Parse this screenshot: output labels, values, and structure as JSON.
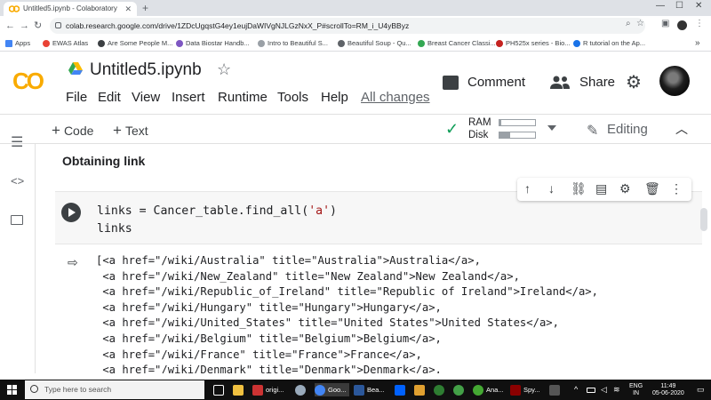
{
  "browser": {
    "tab_title": "Untitled5.ipynb - Colaboratory",
    "url": "colab.research.google.com/drive/1ZDcUgqstG4ey1eujDaWIVgNJLGzNxX_P#scrollTo=RM_i_U4yBByz",
    "bookmarks": [
      "Apps",
      "EWAS Atlas",
      "Are Some People M...",
      "Data Biostar Handb...",
      "Intro to Beautiful S...",
      "Beautiful Soup - Qu...",
      "Breast Cancer Classi...",
      "PH525x series - Bio...",
      "R tutorial on the Ap..."
    ]
  },
  "colab": {
    "logo": "CO",
    "title": "Untitled5.ipynb",
    "menu": [
      "File",
      "Edit",
      "View",
      "Insert",
      "Runtime",
      "Tools",
      "Help"
    ],
    "all_changes": "All changes",
    "comment": "Comment",
    "share": "Share"
  },
  "toolbar": {
    "code": "Code",
    "text": "Text",
    "ram": "RAM",
    "disk": "Disk",
    "ram_usage": 0.05,
    "disk_usage": 0.3,
    "editing": "Editing"
  },
  "notebook": {
    "section_title": "Obtaining link",
    "code_lines": [
      "links = Cancer_table.find_all(",
      "'a'",
      ")",
      "links"
    ],
    "output_lines": [
      "[<a href=\"/wiki/Australia\" title=\"Australia\">Australia</a>,",
      " <a href=\"/wiki/New_Zealand\" title=\"New Zealand\">New Zealand</a>,",
      " <a href=\"/wiki/Republic_of_Ireland\" title=\"Republic of Ireland\">Ireland</a>,",
      " <a href=\"/wiki/Hungary\" title=\"Hungary\">Hungary</a>,",
      " <a href=\"/wiki/United_States\" title=\"United States\">United States</a>,",
      " <a href=\"/wiki/Belgium\" title=\"Belgium\">Belgium</a>,",
      " <a href=\"/wiki/France\" title=\"France\">France</a>,",
      " <a href=\"/wiki/Denmark\" title=\"Denmark\">Denmark</a>,"
    ]
  },
  "taskbar": {
    "search_placeholder": "Type here to search",
    "apps": [
      "origi...",
      "Goo...",
      "Bea...",
      "Ana...",
      "Spy..."
    ],
    "lang_top": "ENG",
    "lang_bottom": "IN",
    "time": "11:49",
    "date": "05-06-2020"
  },
  "colors": {
    "colab_orange": "#f9ab00",
    "check_green": "#0f9d58",
    "taskbar": "#101010"
  }
}
